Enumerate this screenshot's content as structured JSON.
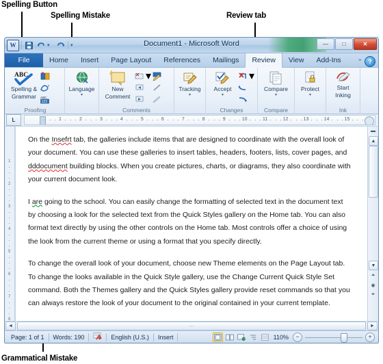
{
  "annotations": [
    {
      "id": "spelling-button",
      "label": "Spelling Button"
    },
    {
      "id": "spelling-mistake",
      "label": "Spelling Mistake"
    },
    {
      "id": "review-tab",
      "label": "Review tab"
    },
    {
      "id": "grammatical-mistake",
      "label": "Grammatical Mistake"
    }
  ],
  "window": {
    "title": "Document1  -  Microsoft Word",
    "quick_access": [
      {
        "name": "word-logo",
        "glyph": "W"
      },
      {
        "name": "save",
        "glyph": "■"
      },
      {
        "name": "undo",
        "glyph": "↶"
      },
      {
        "name": "undo-dropdown",
        "glyph": "▾"
      },
      {
        "name": "redo",
        "glyph": "↷"
      },
      {
        "name": "customize-dropdown",
        "glyph": "▾"
      }
    ],
    "controls": [
      {
        "name": "minimize",
        "glyph": "—"
      },
      {
        "name": "restore",
        "glyph": "□"
      },
      {
        "name": "close",
        "glyph": "✕"
      }
    ]
  },
  "tabs": {
    "file": "File",
    "items": [
      "Home",
      "Insert",
      "Page Layout",
      "References",
      "Mailings",
      "Review",
      "View",
      "Add-Ins"
    ],
    "active": "Review",
    "minimize_ribbon_glyph": "⌃",
    "help_glyph": "?"
  },
  "ribbon": {
    "groups": [
      {
        "name": "Proofing",
        "label": "Proofing",
        "big": {
          "name": "spelling-grammar",
          "line1": "Spelling &",
          "line2": "Grammar",
          "icon": "abc-check-icon"
        },
        "small": [
          {
            "name": "research",
            "icon": "research-icon"
          },
          {
            "name": "thesaurus",
            "icon": "thesaurus-icon"
          },
          {
            "name": "word-count",
            "icon": "word-count-icon"
          }
        ]
      },
      {
        "name": "Language",
        "label": "",
        "big": {
          "name": "language",
          "line1": "Language",
          "line2": "",
          "icon": "globe-icon",
          "caret": "▾"
        },
        "small": []
      },
      {
        "name": "Comments",
        "label": "Comments",
        "big": {
          "name": "new-comment",
          "line1": "New",
          "line2": "Comment",
          "icon": "new-comment-icon"
        },
        "small": [
          {
            "name": "delete-comment",
            "icon": "delete-comment-icon",
            "caret": "▾"
          },
          {
            "name": "previous-comment",
            "icon": "previous-comment-icon"
          },
          {
            "name": "next-comment",
            "icon": "next-comment-icon"
          }
        ],
        "small2": [
          {
            "name": "track-changes-pen",
            "icon": "pen-icon"
          },
          {
            "name": "balloon-line",
            "icon": "line-icon"
          },
          {
            "name": "show-markup",
            "icon": "markup-icon"
          }
        ]
      },
      {
        "name": "Changes-Tracking",
        "label": "",
        "big": {
          "name": "tracking",
          "line1": "Tracking",
          "line2": "",
          "icon": "tracking-icon",
          "caret": "▾"
        },
        "small": []
      },
      {
        "name": "Changes",
        "label": "Changes",
        "big": {
          "name": "accept",
          "line1": "Accept",
          "line2": "",
          "icon": "accept-icon",
          "caret": "▾"
        },
        "small": [
          {
            "name": "reject",
            "icon": "reject-icon",
            "caret": "▾"
          },
          {
            "name": "previous-change",
            "icon": "previous-change-icon"
          },
          {
            "name": "next-change",
            "icon": "next-change-icon"
          }
        ]
      },
      {
        "name": "Compare",
        "label": "Compare",
        "big": {
          "name": "compare",
          "line1": "Compare",
          "line2": "",
          "icon": "compare-icon",
          "caret": "▾"
        },
        "small": []
      },
      {
        "name": "Protect",
        "label": "",
        "big": {
          "name": "protect",
          "line1": "Protect",
          "line2": "",
          "icon": "protect-lock-icon",
          "caret": "▾"
        },
        "small": []
      },
      {
        "name": "Ink",
        "label": "Ink",
        "big": {
          "name": "start-inking",
          "line1": "Start",
          "line2": "Inking",
          "icon": "inking-pen-icon"
        },
        "small": []
      }
    ]
  },
  "ruler": {
    "corner_glyph": "L",
    "ticks": [
      "1",
      "2",
      "3",
      "4",
      "5",
      "6",
      "7",
      "8",
      "9",
      "10",
      "11",
      "12",
      "13",
      "14",
      "15"
    ]
  },
  "document": {
    "paragraphs": [
      {
        "runs": [
          {
            "t": "On the ",
            "s": "normal"
          },
          {
            "t": "Insefrt",
            "s": "misspell"
          },
          {
            "t": " tab, the galleries include items that are designed to coordinate with the overall look of your document. You can use these galleries to insert tables, headers, footers, lists, cover pages, and ",
            "s": "normal"
          },
          {
            "t": "dddocument",
            "s": "misspell"
          },
          {
            "t": " building blocks. When you create pictures, charts, or diagrams, they also coordinate with your current document look.",
            "s": "normal"
          }
        ]
      },
      {
        "runs": [
          {
            "t": "I ",
            "s": "normal"
          },
          {
            "t": "are",
            "s": "grammar"
          },
          {
            "t": " going to the school. You can easily change the formatting of selected text in the document text by choosing a look for the selected text from the Quick Styles gallery on the Home tab. You can also format text directly by using the other controls on the Home tab. Most controls offer a choice of using the look from the current theme or using a format that you specify directly.",
            "s": "normal"
          }
        ]
      },
      {
        "runs": [
          {
            "t": "To change the overall look of your document, choose new Theme elements on the Page Layout tab. To change the looks available in the Quick Style gallery, use the Change Current Quick Style Set command. Both the Themes gallery and the Quick Styles gallery provide reset commands so that you can always restore the look of your document to the original contained in your current template.",
            "s": "normal"
          }
        ]
      }
    ]
  },
  "status": {
    "page": "Page: 1 of 1",
    "words": "Words: 190",
    "proofing_icon": "proofing-errors-icon",
    "language": "English (U.S.)",
    "mode": "Insert",
    "views": [
      {
        "name": "print-layout-view",
        "glyph": "▣",
        "selected": true
      },
      {
        "name": "full-screen-reading-view",
        "glyph": "❐",
        "selected": false
      },
      {
        "name": "web-layout-view",
        "glyph": "⌗",
        "selected": false
      },
      {
        "name": "outline-view",
        "glyph": "≡",
        "selected": false
      },
      {
        "name": "draft-view",
        "glyph": "☰",
        "selected": false
      }
    ],
    "zoom": "110%",
    "zoom_out_glyph": "−",
    "zoom_in_glyph": "+"
  },
  "colors": {
    "accent": "#1d5fa8",
    "misspell": "#d9443f",
    "grammar": "#1f9d3f",
    "close_button": "#b83524",
    "selected_view": "#e0a820"
  }
}
